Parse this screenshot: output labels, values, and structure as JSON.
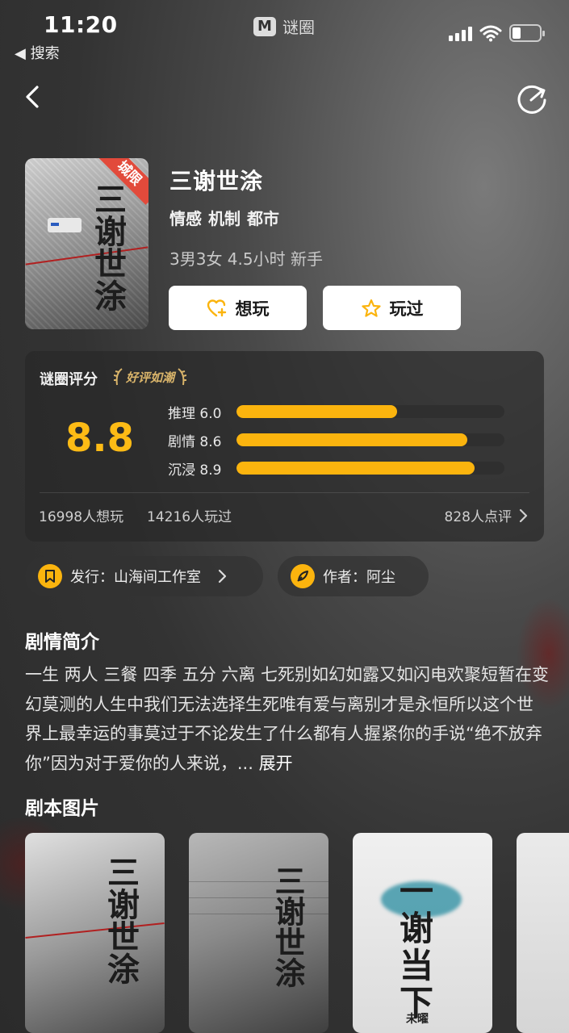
{
  "status_bar": {
    "time": "11:20",
    "back_label": "◀ 搜索",
    "app_name": "谜圈",
    "app_logo": "M"
  },
  "nav": {
    "back_icon": "chevron-left-icon",
    "share_icon": "share-icon"
  },
  "game": {
    "title": "三谢世涂",
    "tags": [
      "情感",
      "机制",
      "都市"
    ],
    "meta": "3男3女 4.5小时 新手",
    "badge": "城限",
    "cover_text": "三谢世涂",
    "want_label": "想玩",
    "played_label": "玩过"
  },
  "rating": {
    "title": "谜圈评分",
    "award": "好评如潮",
    "score": "8.8",
    "bars": [
      {
        "label": "推理 6.0",
        "value": 6.0
      },
      {
        "label": "剧情 8.6",
        "value": 8.6
      },
      {
        "label": "沉浸 8.9",
        "value": 8.9
      }
    ],
    "want_count": "16998人想玩",
    "played_count": "14216人玩过",
    "reviews": "828人点评"
  },
  "publisher": {
    "label": "发行：山海间工作室"
  },
  "author": {
    "label": "作者：阿尘"
  },
  "synopsis": {
    "title": "剧情简介",
    "text": "一生 两人 三餐 四季 五分 六离 七死别如幻如露又如闪电欢聚短暂在变幻莫测的人生中我们无法选择生死唯有爱与离别才是永恒所以这个世界上最幸运的事莫过于不论发生了什么都有人握紧你的手说“绝不放弃你”因为对于爱你的人来说，...",
    "expand": "展开"
  },
  "images": {
    "title": "剧本图片",
    "thumbs": [
      {
        "text": "三谢世涂"
      },
      {
        "text": "三谢世涂"
      },
      {
        "text": "一谢当下",
        "subtitle": "未曜"
      },
      {
        "text": ""
      }
    ]
  },
  "colors": {
    "accent": "#fbb40e",
    "badge": "#e24a3b"
  }
}
